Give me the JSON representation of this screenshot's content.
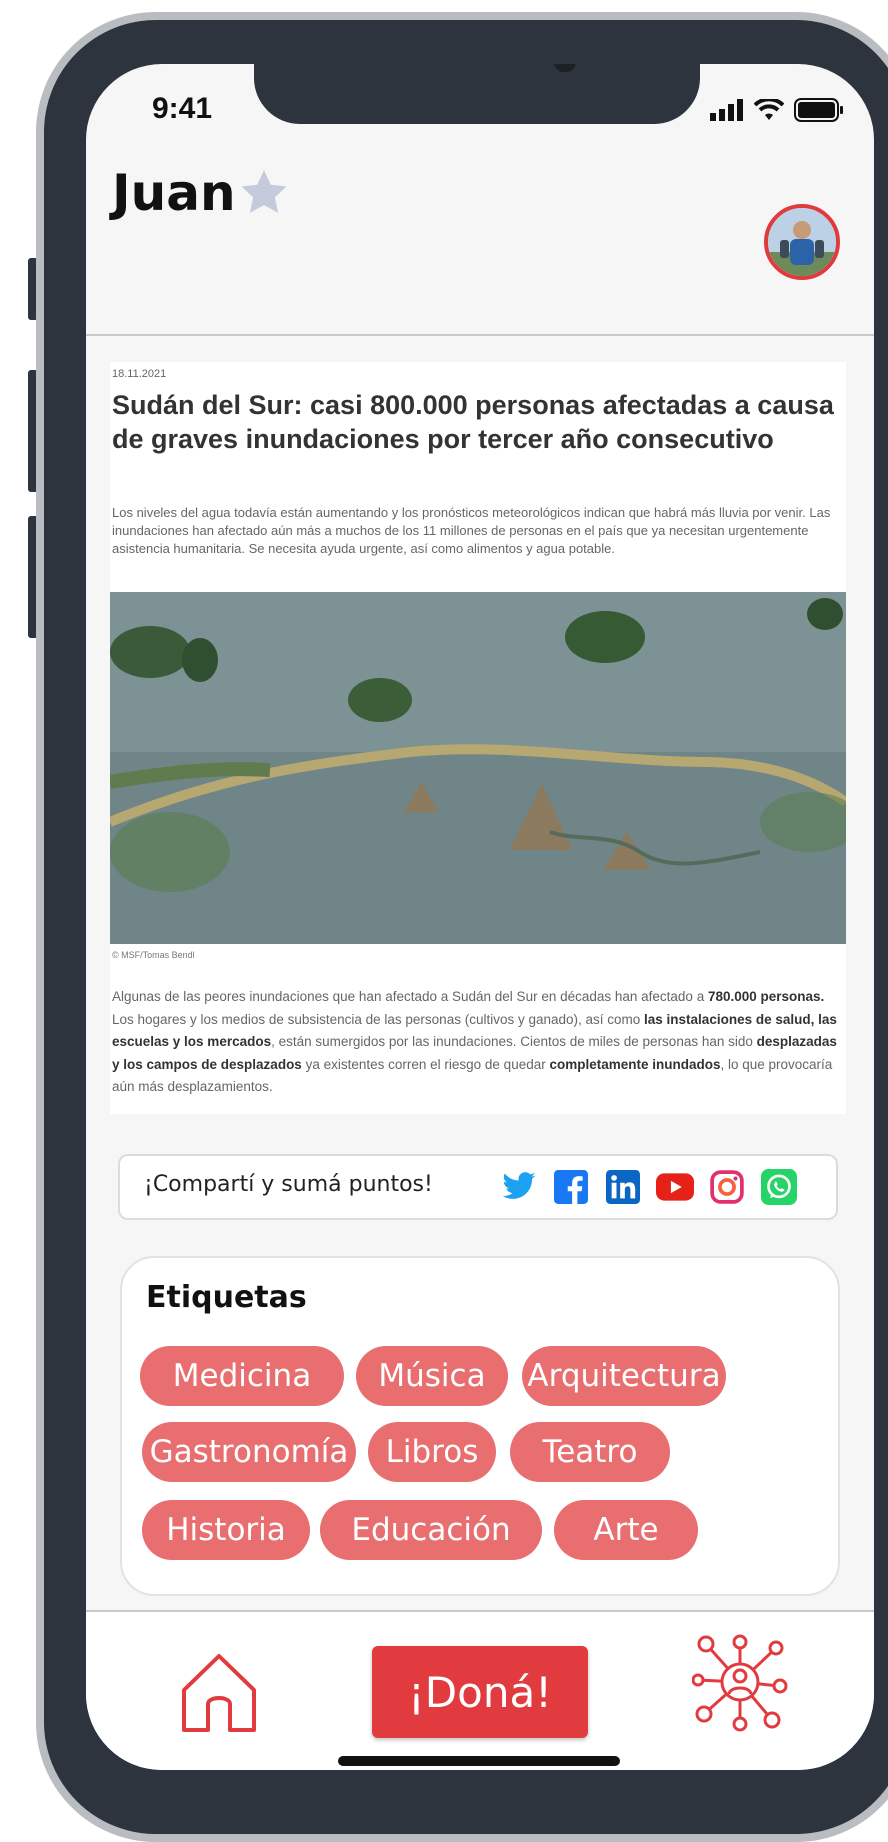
{
  "status": {
    "time": "9:41"
  },
  "header": {
    "user_name": "Juan"
  },
  "article": {
    "date": "18.11.2021",
    "title": "Sudán del Sur: casi 800.000 personas afectadas a causa de graves inundaciones por tercer año consecutivo",
    "lead": "Los niveles del agua todavía están aumentando y los pronósticos meteorológicos indican que habrá más lluvia por venir. Las inundaciones han afectado aún más a muchos de los 11 millones de personas en el país que ya necesitan urgentemente asistencia humanitaria. Se necesita ayuda urgente, así como alimentos y agua potable.",
    "photo_credit": "© MSF/Tomas Bendl",
    "body": {
      "p1": "Algunas de las peores inundaciones que han afectado a Sudán del Sur en décadas han afectado a ",
      "b1": "780.000 personas.",
      "p2": " Los hogares y los medios de subsistencia de las personas (cultivos y ganado), así como ",
      "b2": "las instalaciones de salud, las escuelas y los mercados",
      "p3": ", están sumergidos por las inundaciones. Cientos de miles de personas han sido ",
      "b3": "desplazadas y los campos de desplazados",
      "p4": " ya existentes corren el riesgo de quedar ",
      "b4": "completamente inundados",
      "p5": ", lo que provocaría aún más desplazamientos."
    }
  },
  "share": {
    "label": "¡Compartí y sumá puntos!",
    "icons": [
      "twitter-icon",
      "facebook-icon",
      "linkedin-icon",
      "youtube-icon",
      "instagram-icon",
      "whatsapp-icon"
    ]
  },
  "tags": {
    "title": "Etiquetas",
    "items": [
      "Medicina",
      "Música",
      "Arquitectura",
      "Gastronomía",
      "Libros",
      "Teatro",
      "Historia",
      "Educación",
      "Arte"
    ]
  },
  "nav": {
    "donate_label": "¡Doná!"
  },
  "colors": {
    "accent": "#e13b3f",
    "tag": "#e86e70",
    "star": "#c5cbdc"
  }
}
